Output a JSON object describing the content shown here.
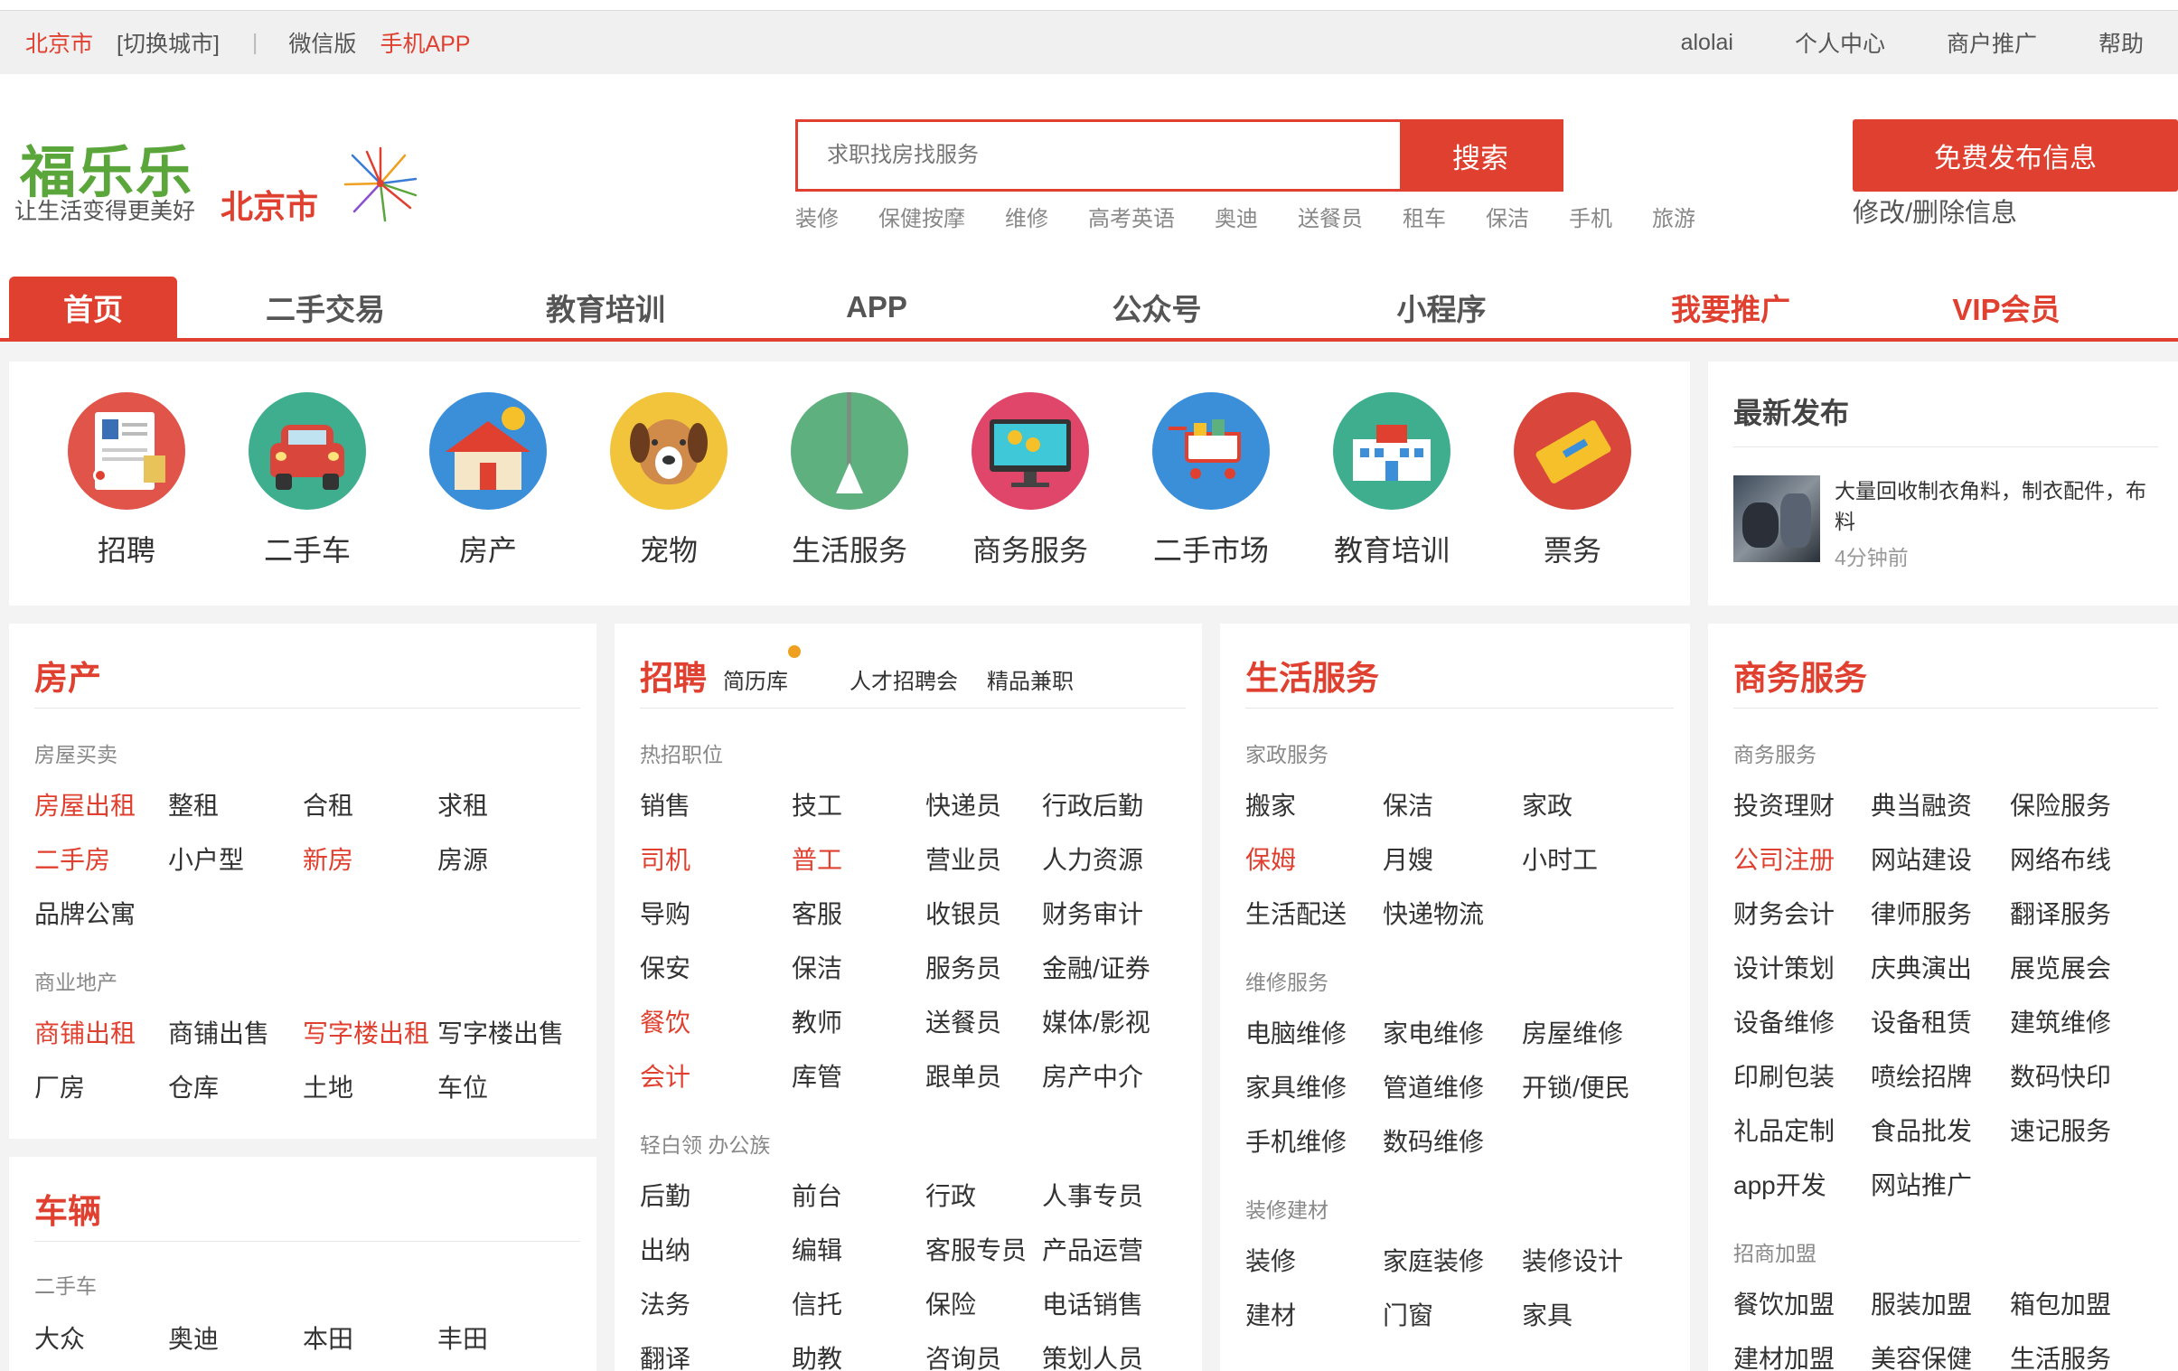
{
  "topbar": {
    "city": "北京市",
    "switch_city": "[切换城市]",
    "sep": "|",
    "wechat": "微信版",
    "app": "手机APP",
    "user": "alolai",
    "personal": "个人中心",
    "merchant": "商户推广",
    "help": "帮助"
  },
  "header": {
    "logo": "福乐乐",
    "slogan": "让生活变得更美好",
    "city": "北京市",
    "search_placeholder": "求职找房找服务",
    "search_btn": "搜索",
    "hot_keywords": [
      "装修",
      "保健按摩",
      "维修",
      "高考英语",
      "奥迪",
      "送餐员",
      "租车",
      "保洁",
      "手机",
      "旅游"
    ],
    "publish_btn": "免费发布信息",
    "edit_link": "修改/删除信息"
  },
  "nav": [
    "首页",
    "二手交易",
    "教育培训",
    "APP",
    "公众号",
    "小程序",
    "我要推广",
    "VIP会员"
  ],
  "categories": [
    "招聘",
    "二手车",
    "房产",
    "宠物",
    "生活服务",
    "商务服务",
    "二手市场",
    "教育培训",
    "票务"
  ],
  "latest": {
    "title": "最新发布",
    "item_text": "大量回收制衣角料，制衣配件，布料",
    "item_time": "4分钟前"
  },
  "house": {
    "title": "房产",
    "sec1": "房屋买卖",
    "row1": [
      "房屋出租",
      "整租",
      "合租",
      "求租"
    ],
    "row2": [
      "二手房",
      "小户型",
      "新房",
      "房源"
    ],
    "row3": [
      "品牌公寓"
    ],
    "sec2": "商业地产",
    "row4": [
      "商铺出租",
      "商铺出售",
      "写字楼出租",
      "写字楼出售"
    ],
    "row5": [
      "厂房",
      "仓库",
      "土地",
      "车位"
    ]
  },
  "cars": {
    "title": "车辆",
    "sec1": "二手车",
    "row1": [
      "大众",
      "奥迪",
      "本田",
      "丰田"
    ]
  },
  "jobs": {
    "title": "招聘",
    "resume": "简历库",
    "fair": "人才招聘会",
    "parttime": "精品兼职",
    "sec1": "热招职位",
    "rows1": [
      [
        "销售",
        "技工",
        "快递员",
        "行政后勤"
      ],
      [
        "司机",
        "普工",
        "营业员",
        "人力资源"
      ],
      [
        "导购",
        "客服",
        "收银员",
        "财务审计"
      ],
      [
        "保安",
        "保洁",
        "服务员",
        "金融/证券"
      ],
      [
        "餐饮",
        "教师",
        "送餐员",
        "媒体/影视"
      ],
      [
        "会计",
        "库管",
        "跟单员",
        "房产中介"
      ]
    ],
    "sec2": "轻白领 办公族",
    "rows2": [
      [
        "后勤",
        "前台",
        "行政",
        "人事专员"
      ],
      [
        "出纳",
        "编辑",
        "客服专员",
        "产品运营"
      ],
      [
        "法务",
        "信托",
        "保险",
        "电话销售"
      ],
      [
        "翻译",
        "助教",
        "咨询员",
        "策划人员"
      ]
    ]
  },
  "life": {
    "title": "生活服务",
    "sec1": "家政服务",
    "rows1": [
      [
        "搬家",
        "保洁",
        "家政"
      ],
      [
        "保姆",
        "月嫂",
        "小时工"
      ],
      [
        "生活配送",
        "快递物流"
      ]
    ],
    "sec2": "维修服务",
    "rows2": [
      [
        "电脑维修",
        "家电维修",
        "房屋维修"
      ],
      [
        "家具维修",
        "管道维修",
        "开锁/便民"
      ],
      [
        "手机维修",
        "数码维修"
      ]
    ],
    "sec3": "装修建材",
    "rows3": [
      [
        "装修",
        "家庭装修",
        "装修设计"
      ],
      [
        "建材",
        "门窗",
        "家具"
      ]
    ]
  },
  "biz": {
    "title": "商务服务",
    "sec1": "商务服务",
    "rows1": [
      [
        "投资理财",
        "典当融资",
        "保险服务"
      ],
      [
        "公司注册",
        "网站建设",
        "网络布线"
      ],
      [
        "财务会计",
        "律师服务",
        "翻译服务"
      ],
      [
        "设计策划",
        "庆典演出",
        "展览展会"
      ],
      [
        "设备维修",
        "设备租赁",
        "建筑维修"
      ],
      [
        "印刷包装",
        "喷绘招牌",
        "数码快印"
      ],
      [
        "礼品定制",
        "食品批发",
        "速记服务"
      ],
      [
        "app开发",
        "网站推广"
      ]
    ],
    "sec2": "招商加盟",
    "rows2": [
      [
        "餐饮加盟",
        "服装加盟",
        "箱包加盟"
      ],
      [
        "建材加盟",
        "美容保健",
        "生活服务"
      ]
    ]
  },
  "colors": {
    "accent": "#e0402f",
    "logo": "#5aa63a"
  }
}
